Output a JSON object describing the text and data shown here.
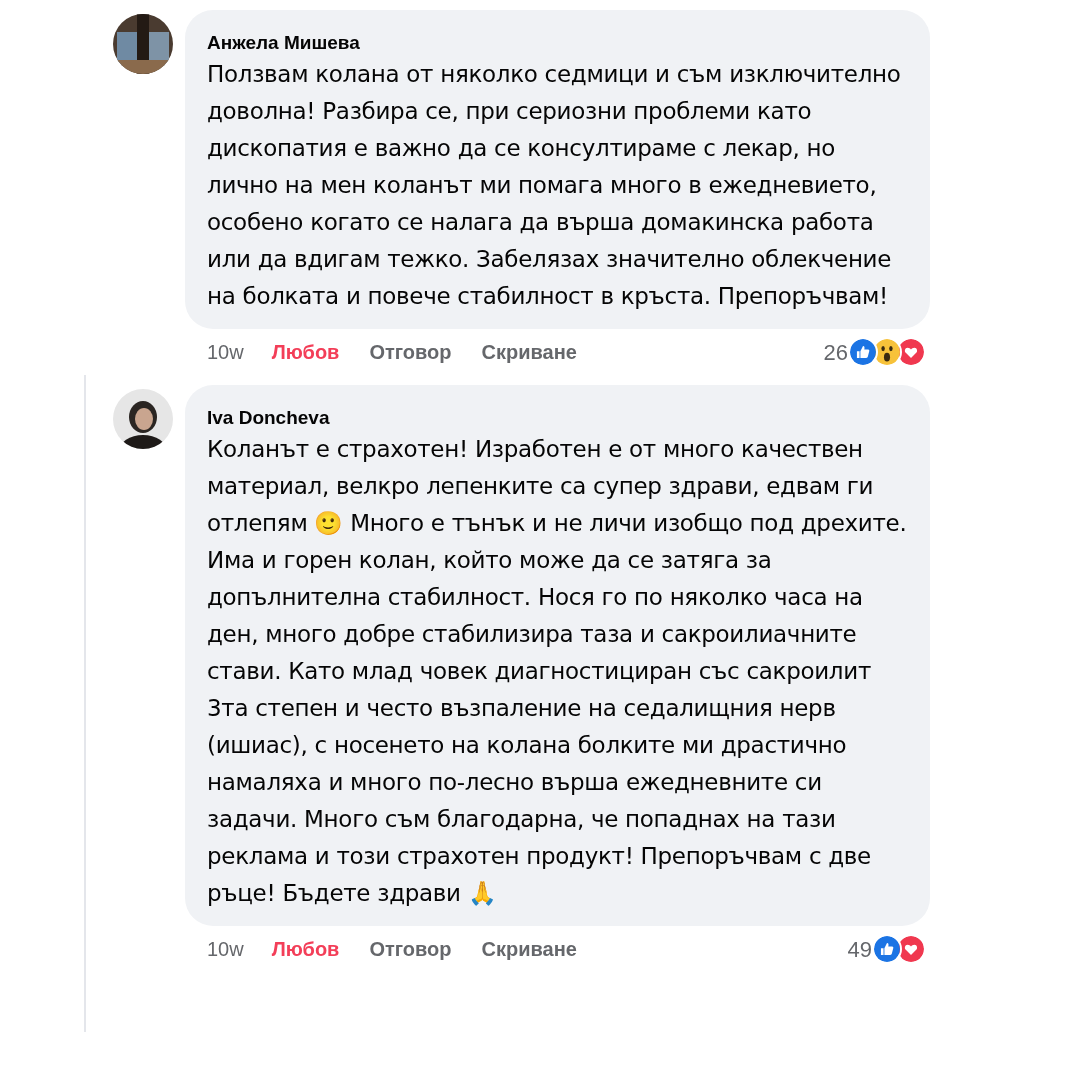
{
  "comments": [
    {
      "author": "Анжела Мишева",
      "text": "Ползвам колана от няколко седмици и съм изключително доволна! Разбира се, при сериозни проблеми като дископатия е важно да се консултираме с лекар, но лично на мен коланът ми помага много в ежедневието, особено когато се налага да върша домакинска работа или да вдигам тежко. Забелязах значително облекчение на болката и повече стабилност в кръста. Препоръчвам!",
      "time": "10w",
      "actions": [
        {
          "label": "Любов",
          "selected": true
        },
        {
          "label": "Отговор",
          "selected": false
        },
        {
          "label": "Скриване",
          "selected": false
        }
      ],
      "reaction_count": "26",
      "reactions": [
        {
          "kind": "like"
        },
        {
          "kind": "wow"
        },
        {
          "kind": "love"
        }
      ],
      "threaded": false
    },
    {
      "author": "Iva Doncheva",
      "text": "Коланът е страхотен! Изработен е от много качествен материал, велкро лепенките са супер здрави, едвам ги отлепям 🙂 Много е тънък и не личи изобщо под дрехите. Има и горен колан, който може да се затяга за допълнителна стабилност. Нося го по няколко часа на ден, много добре стабилизира таза и сакроилиачните стави. Като млад човек диагностициран със сакроилит 3та степен и често възпаление на седалищния нерв (ишиас), с носенето на колана болките ми драстично намаляха и много по-лесно върша ежедневните си задачи. Много съм благодарна, че попаднах на тази реклама и този страхотен продукт! Препоръчвам с две ръце! Бъдете здрави 🙏",
      "time": "10w",
      "actions": [
        {
          "label": "Любов",
          "selected": true
        },
        {
          "label": "Отговор",
          "selected": false
        },
        {
          "label": "Скриване",
          "selected": false
        }
      ],
      "reaction_count": "49",
      "reactions": [
        {
          "kind": "like"
        },
        {
          "kind": "love"
        }
      ],
      "threaded": true
    }
  ]
}
